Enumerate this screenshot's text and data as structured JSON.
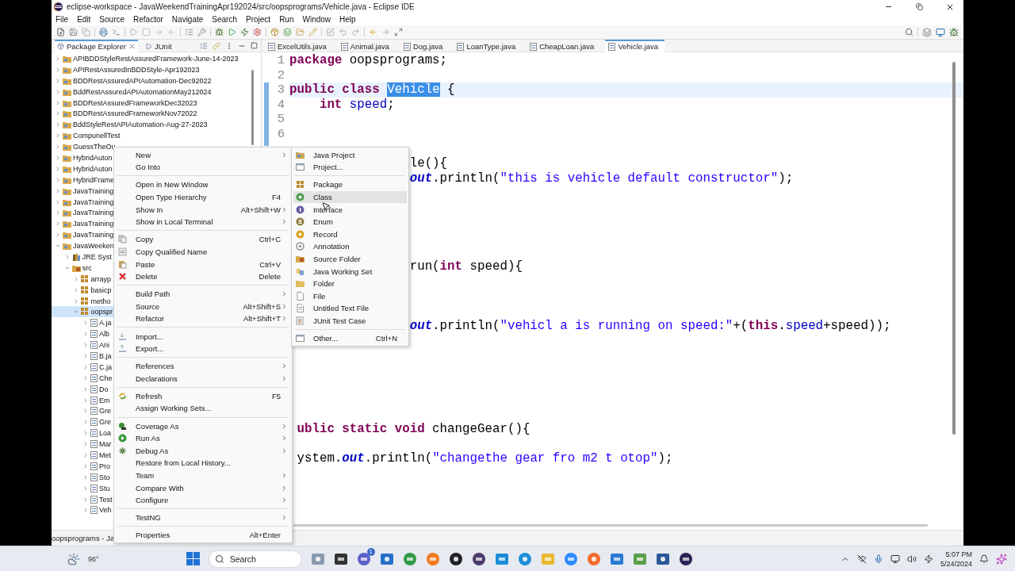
{
  "window": {
    "title": "eclipse-workspace - JavaWeekendTrainingApr192024/src/oopsprograms/Vehicle.java - Eclipse IDE"
  },
  "menubar": [
    "File",
    "Edit",
    "Source",
    "Refactor",
    "Navigate",
    "Search",
    "Project",
    "Run",
    "Window",
    "Help"
  ],
  "explorer": {
    "tabs": [
      {
        "label": "Package Explorer",
        "selected": true
      },
      {
        "label": "JUnit",
        "selected": false
      }
    ],
    "tree": [
      {
        "label": "APIBDDStyleRestAssuredFramework-June-14-2023",
        "kind": "project",
        "expanded": false,
        "selected": false
      },
      {
        "label": "APIRestAssuredInBDDStyle-Apr192023",
        "kind": "project",
        "expanded": false,
        "selected": false
      },
      {
        "label": "BDDRestAssuredAPIAutomation-Dec92022",
        "kind": "project",
        "expanded": false,
        "selected": false
      },
      {
        "label": "BddRestAssuredAPIAutomationMay212024",
        "kind": "project",
        "expanded": false,
        "selected": false
      },
      {
        "label": "BDDRestAssuredFrameworkDec32023",
        "kind": "project",
        "expanded": false,
        "selected": false
      },
      {
        "label": "BDDRestAssuredFrameworkNov72022",
        "kind": "project",
        "expanded": false,
        "selected": false
      },
      {
        "label": "BddStyleRestAPIAutomation-Aug-27-2023",
        "kind": "project",
        "expanded": false,
        "selected": false
      },
      {
        "label": "CompunellTest",
        "kind": "project",
        "expanded": false,
        "selected": false
      },
      {
        "label": "GuessTheOu",
        "kind": "project",
        "expanded": false,
        "selected": false
      },
      {
        "label": "HybridAuton",
        "kind": "project",
        "expanded": false,
        "selected": false
      },
      {
        "label": "HybridAuton",
        "kind": "project",
        "expanded": false,
        "selected": false
      },
      {
        "label": "HybridFrame",
        "kind": "project",
        "expanded": false,
        "selected": false
      },
      {
        "label": "JavaTraining",
        "kind": "project",
        "expanded": false,
        "selected": false
      },
      {
        "label": "JavaTraining",
        "kind": "project",
        "expanded": false,
        "selected": false
      },
      {
        "label": "JavaTraining",
        "kind": "project",
        "expanded": false,
        "selected": false
      },
      {
        "label": "JavaTraining",
        "kind": "project",
        "expanded": false,
        "selected": false
      },
      {
        "label": "JavaTraining",
        "kind": "project",
        "expanded": false,
        "selected": false
      },
      {
        "label": "JavaWeeken",
        "kind": "project",
        "expanded": true,
        "selected": false,
        "children": [
          {
            "label": "JRE Syst",
            "kind": "library",
            "expanded": false,
            "selected": false
          },
          {
            "label": "src",
            "kind": "source-folder",
            "expanded": true,
            "selected": false,
            "children": [
              {
                "label": "arrayp",
                "kind": "package",
                "expanded": false,
                "selected": false
              },
              {
                "label": "basicp",
                "kind": "package",
                "expanded": false,
                "selected": false
              },
              {
                "label": "metho",
                "kind": "package",
                "expanded": false,
                "selected": false
              },
              {
                "label": "oopspr",
                "kind": "package",
                "expanded": true,
                "selected": true,
                "children": [
                  {
                    "label": "A.ja",
                    "kind": "java-file",
                    "expanded": false,
                    "selected": false
                  },
                  {
                    "label": "Alb",
                    "kind": "java-file",
                    "expanded": false,
                    "selected": false
                  },
                  {
                    "label": "Ani",
                    "kind": "java-file",
                    "expanded": false,
                    "selected": false
                  },
                  {
                    "label": "B.ja",
                    "kind": "java-file",
                    "expanded": false,
                    "selected": false
                  },
                  {
                    "label": "C.ja",
                    "kind": "java-file",
                    "expanded": false,
                    "selected": false
                  },
                  {
                    "label": "Che",
                    "kind": "java-file",
                    "expanded": false,
                    "selected": false
                  },
                  {
                    "label": "Do",
                    "kind": "java-file",
                    "expanded": false,
                    "selected": false
                  },
                  {
                    "label": "Em",
                    "kind": "java-file",
                    "expanded": false,
                    "selected": false
                  },
                  {
                    "label": "Gre",
                    "kind": "java-file",
                    "expanded": false,
                    "selected": false
                  },
                  {
                    "label": "Gre",
                    "kind": "java-file",
                    "expanded": false,
                    "selected": false
                  },
                  {
                    "label": "Loa",
                    "kind": "java-file",
                    "expanded": false,
                    "selected": false
                  },
                  {
                    "label": "Mar",
                    "kind": "java-file",
                    "expanded": false,
                    "selected": false
                  },
                  {
                    "label": "Met",
                    "kind": "java-file",
                    "expanded": false,
                    "selected": false
                  },
                  {
                    "label": "Pro",
                    "kind": "java-file",
                    "expanded": false,
                    "selected": false
                  },
                  {
                    "label": "Sto",
                    "kind": "java-file",
                    "expanded": false,
                    "selected": false
                  },
                  {
                    "label": "Stu",
                    "kind": "java-file",
                    "expanded": false,
                    "selected": false
                  },
                  {
                    "label": "Test",
                    "kind": "java-file",
                    "expanded": false,
                    "selected": false
                  },
                  {
                    "label": "Veh",
                    "kind": "java-file",
                    "expanded": false,
                    "selected": false
                  }
                ]
              }
            ]
          }
        ]
      }
    ]
  },
  "editor": {
    "tabs": [
      {
        "label": "ExcelUtils.java",
        "selected": false
      },
      {
        "label": "Animal.java",
        "selected": false
      },
      {
        "label": "Dog.java",
        "selected": false
      },
      {
        "label": "LoanType.java",
        "selected": false
      },
      {
        "label": "CheapLoan.java",
        "selected": false
      },
      {
        "label": "Vehicle.java",
        "selected": true
      }
    ],
    "line_numbers": [
      "1",
      "2",
      "3",
      "4",
      "5",
      "6"
    ],
    "lines": [
      {
        "current": false,
        "tokens": [
          {
            "text": "package",
            "kind": "keyword"
          },
          {
            "text": " oopsprograms;",
            "kind": "plain"
          }
        ]
      },
      {
        "current": false
      },
      {
        "current": true,
        "tokens": [
          {
            "text": "public",
            "kind": "keyword"
          },
          {
            "text": " class ",
            "kind": "keyword"
          },
          {
            "text": "Vehicle",
            "kind": "selection"
          },
          {
            "text": " {",
            "kind": "plain"
          }
        ]
      },
      {
        "current": false,
        "tokens": [
          {
            "text": "    int",
            "kind": "keyword"
          },
          {
            "text": " speed",
            "kind": "field"
          },
          {
            "text": ";",
            "kind": "plain"
          }
        ]
      },
      {
        "current": false
      },
      {
        "current": false
      },
      {
        "current": false
      },
      {
        "current": false,
        "tokens": [
          {
            "text": "                le(){",
            "kind": "plain"
          }
        ]
      },
      {
        "current": false,
        "tokens": [
          {
            "text": "                out",
            "kind": "static"
          },
          {
            "text": ".println(",
            "kind": "plain"
          },
          {
            "text": "\"this is vehicle default constructor\"",
            "kind": "string"
          },
          {
            "text": ");",
            "kind": "plain"
          }
        ]
      },
      {
        "current": false
      },
      {
        "current": false
      },
      {
        "current": false
      },
      {
        "current": false
      },
      {
        "current": false
      },
      {
        "current": false,
        "tokens": [
          {
            "text": "                run(",
            "kind": "plain"
          },
          {
            "text": "int",
            "kind": "keyword"
          },
          {
            "text": " speed){",
            "kind": "plain"
          }
        ]
      },
      {
        "current": false
      },
      {
        "current": false
      },
      {
        "current": false
      },
      {
        "current": false,
        "tokens": [
          {
            "text": "                out",
            "kind": "static"
          },
          {
            "text": ".println(",
            "kind": "plain"
          },
          {
            "text": "\"vehicl a is running on speed:\"",
            "kind": "string"
          },
          {
            "text": "+(",
            "kind": "plain"
          },
          {
            "text": "this",
            "kind": "keyword"
          },
          {
            "text": ".",
            "kind": "plain"
          },
          {
            "text": "speed",
            "kind": "field"
          },
          {
            "text": "+speed));",
            "kind": "plain"
          }
        ]
      },
      {
        "current": false
      },
      {
        "current": false
      },
      {
        "current": false
      },
      {
        "current": false
      },
      {
        "current": false
      },
      {
        "current": false
      },
      {
        "current": false,
        "tokens": [
          {
            "text": " ublic",
            "kind": "keyword"
          },
          {
            "text": " static",
            "kind": "keyword"
          },
          {
            "text": " void",
            "kind": "keyword"
          },
          {
            "text": " changeGear(){",
            "kind": "plain"
          }
        ]
      },
      {
        "current": false
      },
      {
        "current": false,
        "tokens": [
          {
            "text": " ystem.",
            "kind": "plain"
          },
          {
            "text": "out",
            "kind": "static"
          },
          {
            "text": ".println(",
            "kind": "plain"
          },
          {
            "text": "\"changethe gear fro m2 t otop\"",
            "kind": "string"
          },
          {
            "text": ");",
            "kind": "plain"
          }
        ]
      }
    ]
  },
  "context_menu": {
    "items": [
      {
        "kind": "item",
        "label": "New",
        "has_submenu": true,
        "selected": false
      },
      {
        "kind": "item",
        "label": "Go Into",
        "has_submenu": false,
        "selected": false
      },
      {
        "kind": "separator"
      },
      {
        "kind": "item",
        "label": "Open in New Window",
        "has_submenu": false,
        "selected": false
      },
      {
        "kind": "item",
        "label": "Open Type Hierarchy",
        "shortcut": "F4",
        "has_submenu": false,
        "selected": false
      },
      {
        "kind": "item",
        "label": "Show In",
        "shortcut": "Alt+Shift+W",
        "has_submenu": true,
        "selected": false
      },
      {
        "kind": "item",
        "label": "Show in Local Terminal",
        "has_submenu": true,
        "selected": false
      },
      {
        "kind": "separator"
      },
      {
        "kind": "item",
        "label": "Copy",
        "shortcut": "Ctrl+C",
        "has_submenu": false,
        "selected": false
      },
      {
        "kind": "item",
        "label": "Copy Qualified Name",
        "has_submenu": false,
        "selected": false
      },
      {
        "kind": "item",
        "label": "Paste",
        "shortcut": "Ctrl+V",
        "has_submenu": false,
        "selected": false
      },
      {
        "kind": "item",
        "label": "Delete",
        "shortcut": "Delete",
        "has_submenu": false,
        "selected": false
      },
      {
        "kind": "separator"
      },
      {
        "kind": "item",
        "label": "Build Path",
        "has_submenu": true,
        "selected": false
      },
      {
        "kind": "item",
        "label": "Source",
        "shortcut": "Alt+Shift+S",
        "has_submenu": true,
        "selected": false
      },
      {
        "kind": "item",
        "label": "Refactor",
        "shortcut": "Alt+Shift+T",
        "has_submenu": true,
        "selected": false
      },
      {
        "kind": "separator"
      },
      {
        "kind": "item",
        "label": "Import...",
        "has_submenu": false,
        "selected": false
      },
      {
        "kind": "item",
        "label": "Export...",
        "has_submenu": false,
        "selected": false
      },
      {
        "kind": "separator"
      },
      {
        "kind": "item",
        "label": "References",
        "has_submenu": true,
        "selected": false
      },
      {
        "kind": "item",
        "label": "Declarations",
        "has_submenu": true,
        "selected": false
      },
      {
        "kind": "separator"
      },
      {
        "kind": "item",
        "label": "Refresh",
        "shortcut": "F5",
        "has_submenu": false,
        "selected": false
      },
      {
        "kind": "item",
        "label": "Assign Working Sets...",
        "has_submenu": false,
        "selected": false
      },
      {
        "kind": "separator"
      },
      {
        "kind": "item",
        "label": "Coverage As",
        "has_submenu": true,
        "selected": false
      },
      {
        "kind": "item",
        "label": "Run As",
        "has_submenu": true,
        "selected": false
      },
      {
        "kind": "item",
        "label": "Debug As",
        "has_submenu": true,
        "selected": false
      },
      {
        "kind": "item",
        "label": "Restore from Local History...",
        "has_submenu": false,
        "selected": false
      },
      {
        "kind": "item",
        "label": "Team",
        "has_submenu": true,
        "selected": false
      },
      {
        "kind": "item",
        "label": "Compare With",
        "has_submenu": true,
        "selected": false
      },
      {
        "kind": "item",
        "label": "Configure",
        "has_submenu": true,
        "selected": false
      },
      {
        "kind": "separator"
      },
      {
        "kind": "item",
        "label": "TestNG",
        "has_submenu": true,
        "selected": false
      },
      {
        "kind": "separator"
      },
      {
        "kind": "item",
        "label": "Properties",
        "shortcut": "Alt+Enter",
        "has_submenu": false,
        "selected": false
      }
    ]
  },
  "submenu": {
    "items": [
      {
        "kind": "item",
        "label": "Java Project",
        "has_submenu": false,
        "selected": false
      },
      {
        "kind": "item",
        "label": "Project...",
        "has_submenu": false,
        "selected": false
      },
      {
        "kind": "separator"
      },
      {
        "kind": "item",
        "label": "Package",
        "has_submenu": false,
        "selected": false
      },
      {
        "kind": "item",
        "label": "Class",
        "has_submenu": false,
        "selected": true
      },
      {
        "kind": "item",
        "label": "Interface",
        "has_submenu": false,
        "selected": false
      },
      {
        "kind": "item",
        "label": "Enum",
        "has_submenu": false,
        "selected": false
      },
      {
        "kind": "item",
        "label": "Record",
        "has_submenu": false,
        "selected": false
      },
      {
        "kind": "item",
        "label": "Annotation",
        "has_submenu": false,
        "selected": false
      },
      {
        "kind": "item",
        "label": "Source Folder",
        "has_submenu": false,
        "selected": false
      },
      {
        "kind": "item",
        "label": "Java Working Set",
        "has_submenu": false,
        "selected": false
      },
      {
        "kind": "item",
        "label": "Folder",
        "has_submenu": false,
        "selected": false
      },
      {
        "kind": "item",
        "label": "File",
        "has_submenu": false,
        "selected": false
      },
      {
        "kind": "item",
        "label": "Untitled Text File",
        "has_submenu": false,
        "selected": false
      },
      {
        "kind": "item",
        "label": "JUnit Test Case",
        "has_submenu": false,
        "selected": false
      },
      {
        "kind": "separator"
      },
      {
        "kind": "item",
        "label": "Other...",
        "shortcut": "Ctrl+N",
        "has_submenu": false,
        "selected": false
      }
    ]
  },
  "status_bar": {
    "text": "oopsprograms - Ja"
  },
  "taskbar": {
    "temperature": "96°",
    "search": {
      "placeholder": "Search"
    },
    "badge": "1",
    "time": "5:07 PM",
    "date": "5/24/2024"
  }
}
